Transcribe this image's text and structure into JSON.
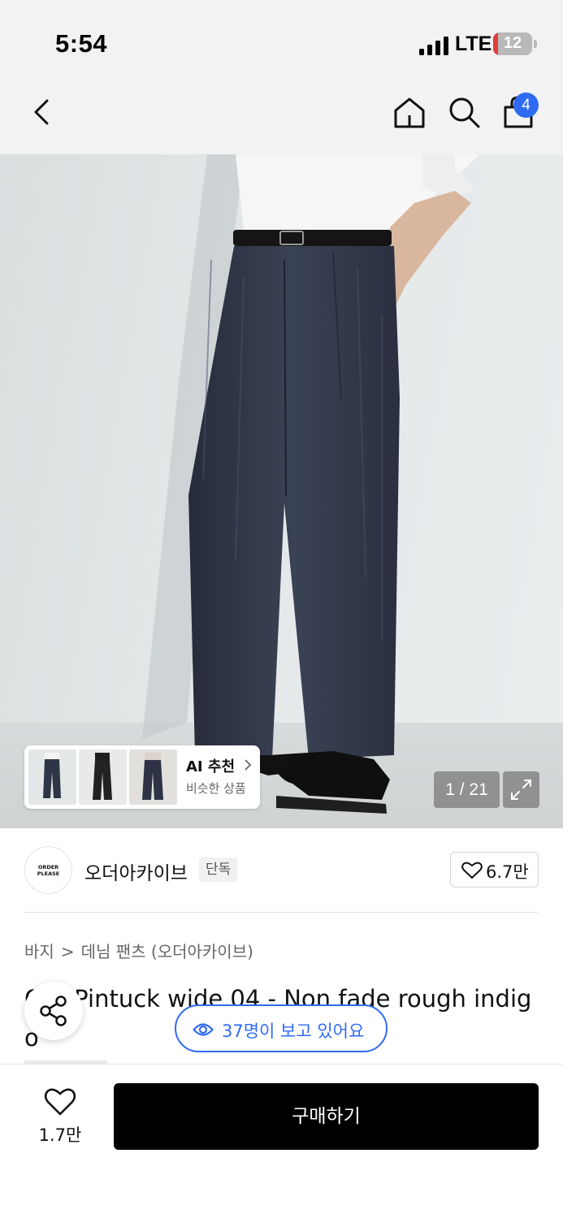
{
  "status_bar": {
    "time": "5:54",
    "network": "LTE",
    "battery": "12",
    "battery_level": 0.12,
    "battery_color": "#e53b3b"
  },
  "nav": {
    "icons": [
      "back-icon",
      "home-icon",
      "search-icon",
      "cart-icon"
    ],
    "cart_count": "4",
    "accent_color": "#2f6bf2"
  },
  "gallery": {
    "ai_title": "AI 추천",
    "ai_subtitle": "비슷한 상품",
    "counter": "1 / 21",
    "icons": [
      "expand-icon",
      "chevron-right-icon"
    ]
  },
  "brand": {
    "logo_line1": "ORDER",
    "logo_line2": "PLEASE",
    "name": "오더아카이브",
    "badge": "단독",
    "likes": "6.7만"
  },
  "breadcrumb": {
    "items": [
      "바지",
      "데님 팬츠 (오더아카이브)"
    ],
    "separator": ">"
  },
  "product": {
    "title": "Ore Pintuck wide 04 - Non fade rough indigo"
  },
  "viewers": {
    "text": "37명이 보고 있어요",
    "color": "#2f6bf2"
  },
  "bottom_bar": {
    "wish_count": "1.7만",
    "buy_label": "구매하기"
  }
}
